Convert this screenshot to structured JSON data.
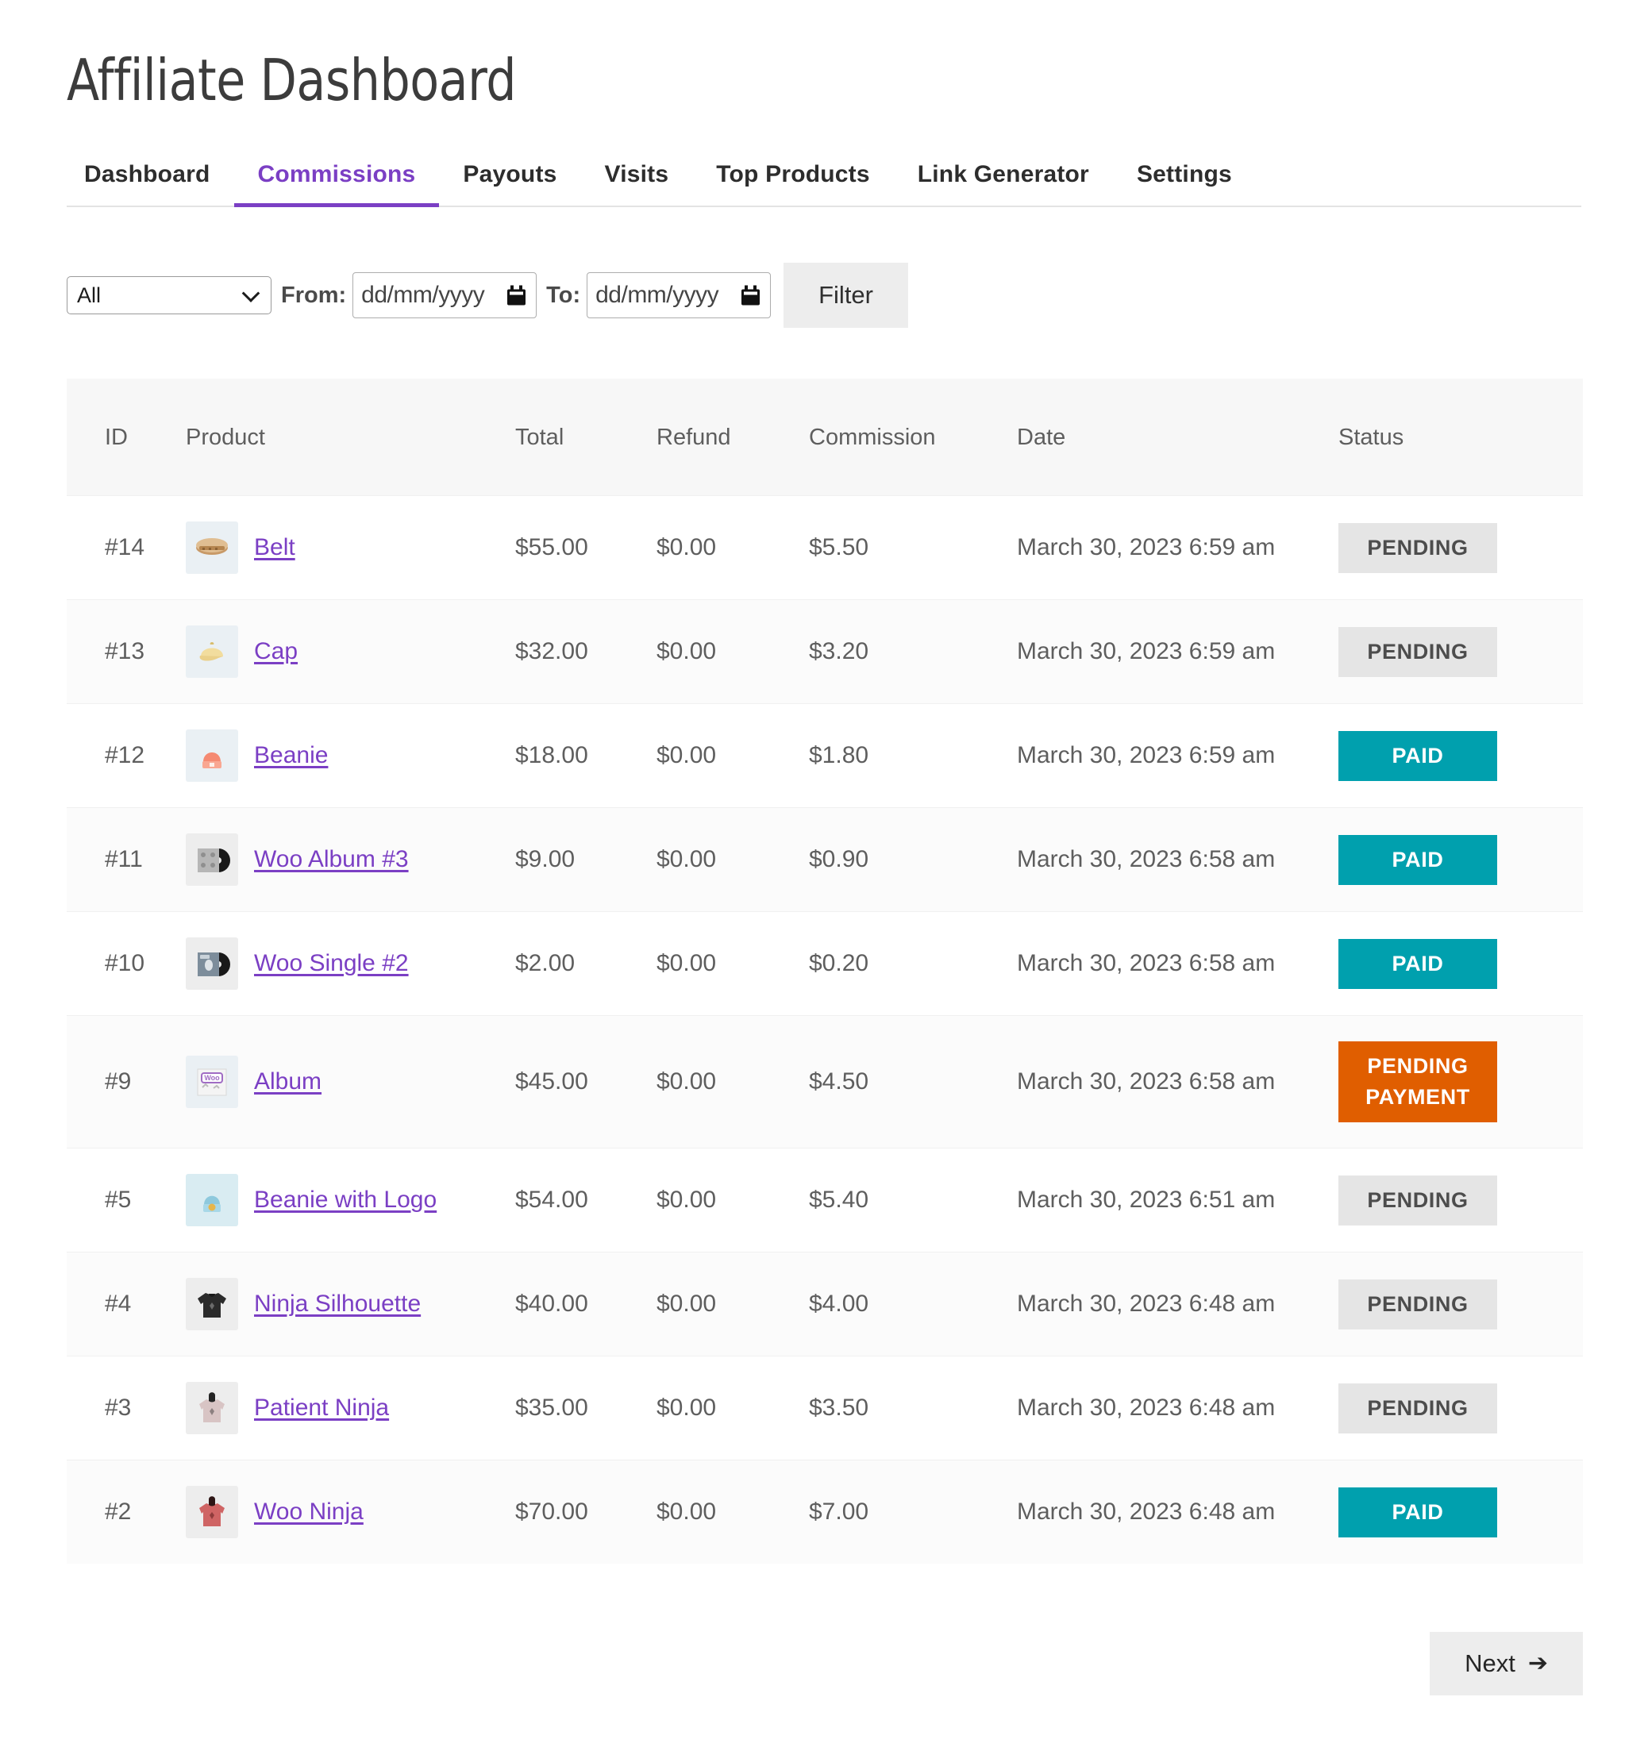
{
  "page": {
    "title": "Affiliate Dashboard"
  },
  "tabs": [
    {
      "label": "Dashboard",
      "active": false
    },
    {
      "label": "Commissions",
      "active": true
    },
    {
      "label": "Payouts",
      "active": false
    },
    {
      "label": "Visits",
      "active": false
    },
    {
      "label": "Top Products",
      "active": false
    },
    {
      "label": "Link Generator",
      "active": false
    },
    {
      "label": "Settings",
      "active": false
    }
  ],
  "filters": {
    "status_select": {
      "value": "All",
      "options": [
        "All"
      ]
    },
    "from_label": "From:",
    "from_date": {
      "value": "",
      "placeholder": "dd/mm/yyyy"
    },
    "to_label": "To:",
    "to_date": {
      "value": "",
      "placeholder": "dd/mm/yyyy"
    },
    "filter_button": "Filter"
  },
  "table": {
    "columns": [
      "ID",
      "Product",
      "Total",
      "Refund",
      "Commission",
      "Date",
      "Status"
    ],
    "rows": [
      {
        "id": "#14",
        "product": "Belt",
        "thumb": "belt-thumbnail",
        "total": "$55.00",
        "refund": "$0.00",
        "commission": "$5.50",
        "date": "March 30, 2023 6:59 am",
        "status": "PENDING",
        "status_kind": "pending"
      },
      {
        "id": "#13",
        "product": "Cap",
        "thumb": "cap-thumbnail",
        "total": "$32.00",
        "refund": "$0.00",
        "commission": "$3.20",
        "date": "March 30, 2023 6:59 am",
        "status": "PENDING",
        "status_kind": "pending"
      },
      {
        "id": "#12",
        "product": "Beanie",
        "thumb": "beanie-thumbnail",
        "total": "$18.00",
        "refund": "$0.00",
        "commission": "$1.80",
        "date": "March 30, 2023 6:59 am",
        "status": "PAID",
        "status_kind": "paid"
      },
      {
        "id": "#11",
        "product": "Woo Album #3",
        "thumb": "album3-thumbnail",
        "total": "$9.00",
        "refund": "$0.00",
        "commission": "$0.90",
        "date": "March 30, 2023 6:58 am",
        "status": "PAID",
        "status_kind": "paid"
      },
      {
        "id": "#10",
        "product": "Woo Single #2",
        "thumb": "single2-thumbnail",
        "total": "$2.00",
        "refund": "$0.00",
        "commission": "$0.20",
        "date": "March 30, 2023 6:58 am",
        "status": "PAID",
        "status_kind": "paid"
      },
      {
        "id": "#9",
        "product": "Album",
        "thumb": "album-thumbnail",
        "total": "$45.00",
        "refund": "$0.00",
        "commission": "$4.50",
        "date": "March 30, 2023 6:58 am",
        "status": "PENDING PAYMENT",
        "status_kind": "pending-payment"
      },
      {
        "id": "#5",
        "product": "Beanie with Logo",
        "thumb": "beanie-logo-thumbnail",
        "total": "$54.00",
        "refund": "$0.00",
        "commission": "$5.40",
        "date": "March 30, 2023 6:51 am",
        "status": "PENDING",
        "status_kind": "pending"
      },
      {
        "id": "#4",
        "product": "Ninja Silhouette",
        "thumb": "tshirt-thumbnail",
        "total": "$40.00",
        "refund": "$0.00",
        "commission": "$4.00",
        "date": "March 30, 2023 6:48 am",
        "status": "PENDING",
        "status_kind": "pending"
      },
      {
        "id": "#3",
        "product": "Patient Ninja",
        "thumb": "hoodie-pink-thumbnail",
        "total": "$35.00",
        "refund": "$0.00",
        "commission": "$3.50",
        "date": "March 30, 2023 6:48 am",
        "status": "PENDING",
        "status_kind": "pending"
      },
      {
        "id": "#2",
        "product": "Woo Ninja",
        "thumb": "hoodie-red-thumbnail",
        "total": "$70.00",
        "refund": "$0.00",
        "commission": "$7.00",
        "date": "March 30, 2023 6:48 am",
        "status": "PAID",
        "status_kind": "paid"
      }
    ]
  },
  "pagination": {
    "next_label": "Next",
    "next_arrow": "➔"
  },
  "colors": {
    "accent_purple": "#7b3fc4",
    "paid_teal": "#00a0ae",
    "pending_gray": "#e5e5e5",
    "pending_payment_orange": "#e05e00",
    "header_bg": "#f7f7f7",
    "button_bg": "#ededed"
  }
}
